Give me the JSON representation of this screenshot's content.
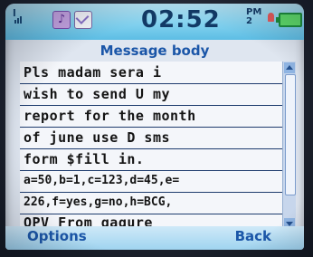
{
  "status": {
    "signal_label": "l",
    "time": "02:52",
    "ampm": "PM 2",
    "colors": {
      "accent": "#1b56a8",
      "statusbar": "#7fd0ee",
      "battery": "#5fe06a"
    }
  },
  "screen": {
    "title": "Message body",
    "lines": [
      "Pls madam sera i",
      "wish to send U my",
      "report for the month",
      "of june use D sms",
      "form $fill in.",
      "a=50,b=1,c=123,d=45,e=",
      "226,f=yes,g=no,h=BCG,",
      "OPV From gagure"
    ]
  },
  "softkeys": {
    "left": "Options",
    "right": "Back"
  }
}
